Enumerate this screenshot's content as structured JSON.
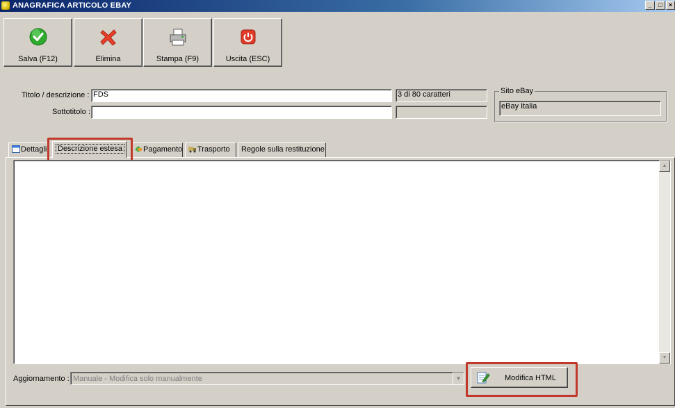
{
  "window": {
    "title": "ANAGRAFICA ARTICOLO EBAY",
    "minimize_icon": "minimize-icon",
    "maximize_icon": "maximize-icon",
    "close_icon": "close-icon"
  },
  "toolbar": {
    "save_label": "Salva (F12)",
    "delete_label": "Elimina",
    "print_label": "Stampa (F9)",
    "exit_label": "Uscita (ESC)"
  },
  "form": {
    "title_label": "Titolo / descrizione :",
    "title_value": "FDS",
    "title_counter": "3 di 80 caratteri",
    "subtitle_label": "Sottotitolo :",
    "subtitle_value": "",
    "subtitle_counter": ""
  },
  "site_group": {
    "legend": "Sito eBay",
    "value": "eBay Italia"
  },
  "tabs": [
    {
      "label": "Dettagli"
    },
    {
      "label": "Descrizione estesa"
    },
    {
      "label": "Pagamento"
    },
    {
      "label": "Trasporto"
    },
    {
      "label": "Regole sulla restituzione"
    }
  ],
  "active_tab": "Descrizione estesa",
  "update": {
    "label": "Aggiornamento :",
    "value": "Manuale - Modifica solo manualmente"
  },
  "edit_html_label": "Modifica HTML",
  "colors": {
    "highlight": "#c0392b",
    "titlebar": "#0a246a"
  }
}
